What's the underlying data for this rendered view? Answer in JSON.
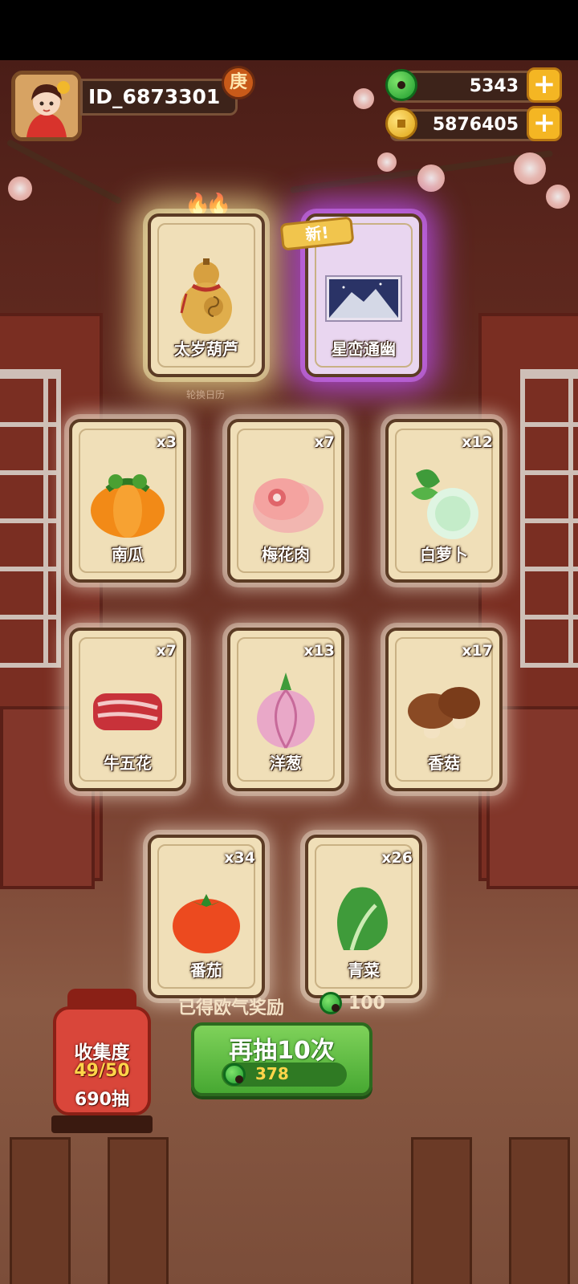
{
  "header": {
    "player_id": "ID_6873301",
    "badge_char": "庚",
    "jade_amount": "5343",
    "coin_amount": "5876405"
  },
  "featured_cards": [
    {
      "name": "太岁葫芦",
      "tag": "",
      "icon": "gourd-icon"
    },
    {
      "name": "星峦通幽",
      "tag": "新!",
      "icon": "landscape-icon"
    }
  ],
  "featured_caption": "轮换日历",
  "cards": [
    {
      "name": "南瓜",
      "count": "x3",
      "icon": "pumpkin-icon"
    },
    {
      "name": "梅花肉",
      "count": "x7",
      "icon": "pork-icon"
    },
    {
      "name": "白萝卜",
      "count": "x12",
      "icon": "radish-icon"
    },
    {
      "name": "牛五花",
      "count": "x7",
      "icon": "beef-icon"
    },
    {
      "name": "洋葱",
      "count": "x13",
      "icon": "onion-icon"
    },
    {
      "name": "香菇",
      "count": "x17",
      "icon": "mushroom-icon"
    },
    {
      "name": "番茄",
      "count": "x34",
      "icon": "tomato-icon"
    },
    {
      "name": "青菜",
      "count": "x26",
      "icon": "greens-icon"
    }
  ],
  "reward": {
    "label": "已得欧气奖励",
    "amount": "100"
  },
  "collection": {
    "title": "收集度",
    "progress": "49/50",
    "draws": "690抽"
  },
  "draw_button": {
    "label": "再抽10次",
    "cost": "378"
  },
  "colors": {
    "accent_green": "#47a832",
    "gold": "#f4b623",
    "lantern_red": "#d9463a"
  }
}
